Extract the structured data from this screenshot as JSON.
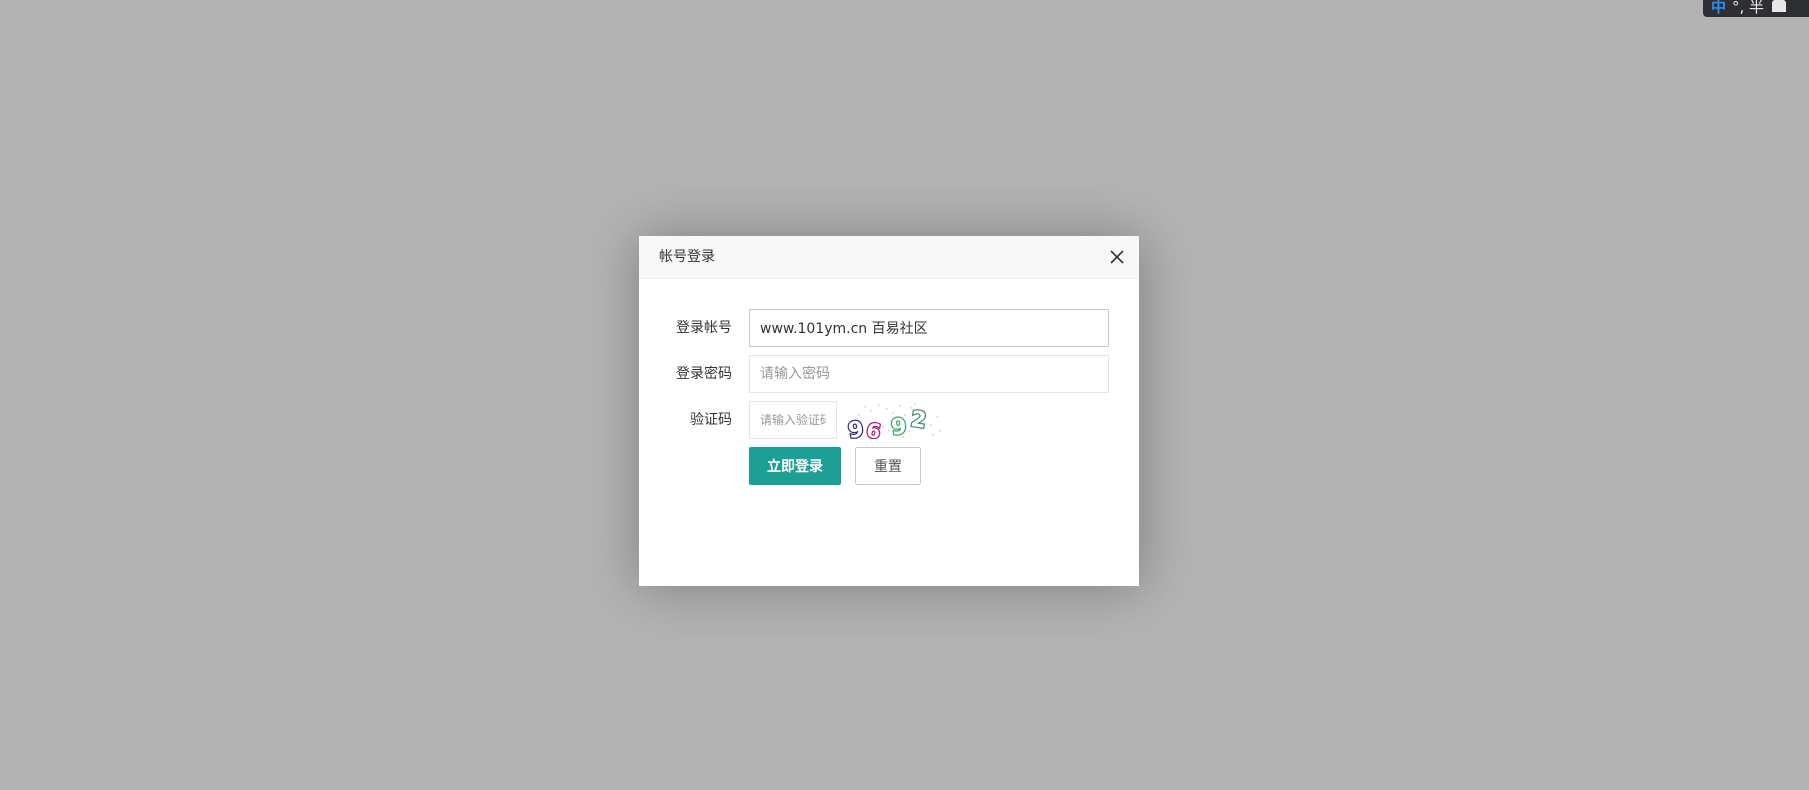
{
  "ime": {
    "mode_label": "中",
    "punct_label": "°, 半"
  },
  "dialog": {
    "title": "帐号登录",
    "close_icon": "close-icon"
  },
  "form": {
    "account": {
      "label": "登录帐号",
      "value": "www.101ym.cn 百易社区",
      "placeholder": ""
    },
    "password": {
      "label": "登录密码",
      "value": "",
      "placeholder": "请输入密码"
    },
    "captcha": {
      "label": "验证码",
      "value": "",
      "placeholder": "请输入验证码",
      "image_text": "9692"
    }
  },
  "buttons": {
    "login": "立即登录",
    "reset": "重置"
  },
  "colors": {
    "overlay": "#b3b3b3",
    "primary": "#1e9f95"
  }
}
